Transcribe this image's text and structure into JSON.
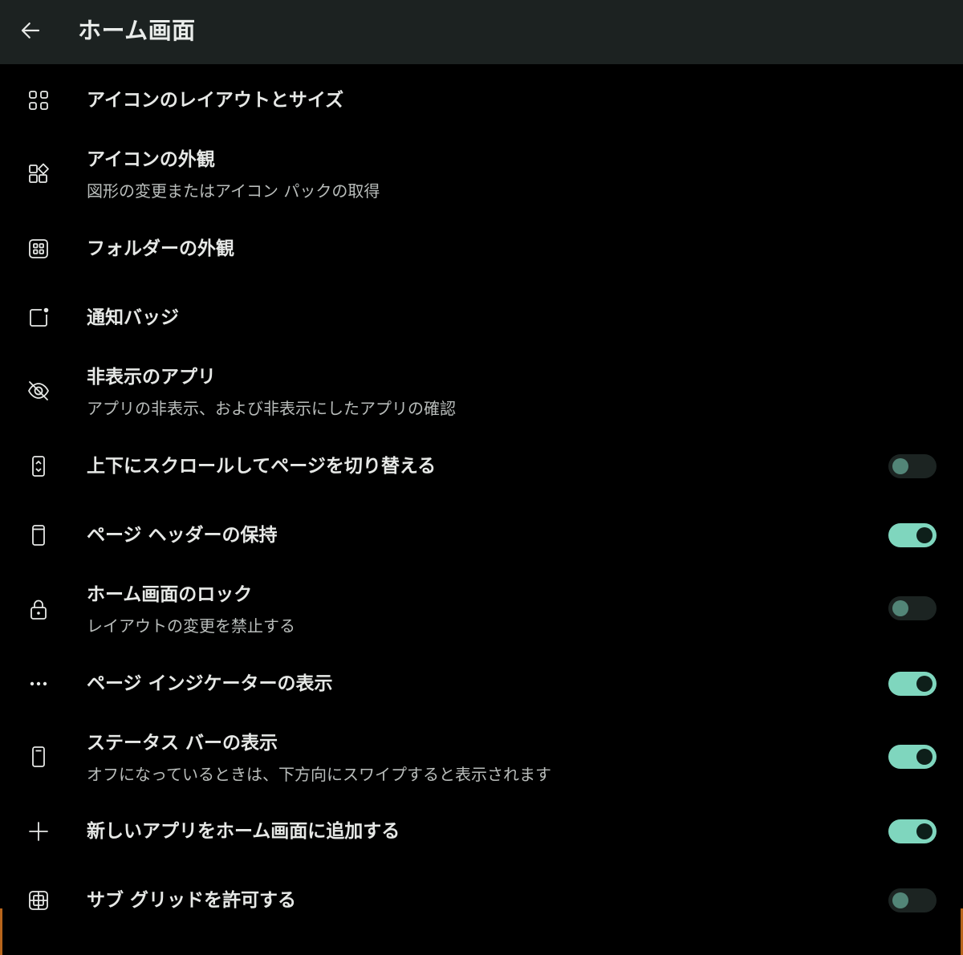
{
  "header": {
    "title": "ホーム画面",
    "back_icon": "arrow-back-icon"
  },
  "colors": {
    "background": "#000000",
    "header_bg": "#1c2221",
    "accent": "#7fd6be",
    "text_primary": "#e6e8e6",
    "text_secondary": "#b9bdbb"
  },
  "items": [
    {
      "icon": "grid-icon",
      "title": "アイコンのレイアウトとサイズ"
    },
    {
      "icon": "shapes-icon",
      "title": "アイコンの外観",
      "subtitle": "図形の変更またはアイコン パックの取得"
    },
    {
      "icon": "folder-grid-icon",
      "title": "フォルダーの外観"
    },
    {
      "icon": "notification-badge-icon",
      "title": "通知バッジ"
    },
    {
      "icon": "eye-off-icon",
      "title": "非表示のアプリ",
      "subtitle": "アプリの非表示、および非表示にしたアプリの確認"
    },
    {
      "icon": "scroll-vertical-icon",
      "title": "上下にスクロールしてページを切り替える",
      "toggle": "off"
    },
    {
      "icon": "phone-header-icon",
      "title": "ページ ヘッダーの保持",
      "toggle": "on"
    },
    {
      "icon": "lock-icon",
      "title": "ホーム画面のロック",
      "subtitle": "レイアウトの変更を禁止する",
      "toggle": "off"
    },
    {
      "icon": "more-horiz-icon",
      "title": "ページ インジケーターの表示",
      "toggle": "on"
    },
    {
      "icon": "phone-status-icon",
      "title": "ステータス バーの表示",
      "subtitle": "オフになっているときは、下方向にスワイプすると表示されます",
      "toggle": "on"
    },
    {
      "icon": "plus-icon",
      "title": "新しいアプリをホーム画面に追加する",
      "toggle": "on"
    },
    {
      "icon": "sub-grid-icon",
      "title": "サブ グリッドを許可する",
      "toggle": "off"
    }
  ]
}
